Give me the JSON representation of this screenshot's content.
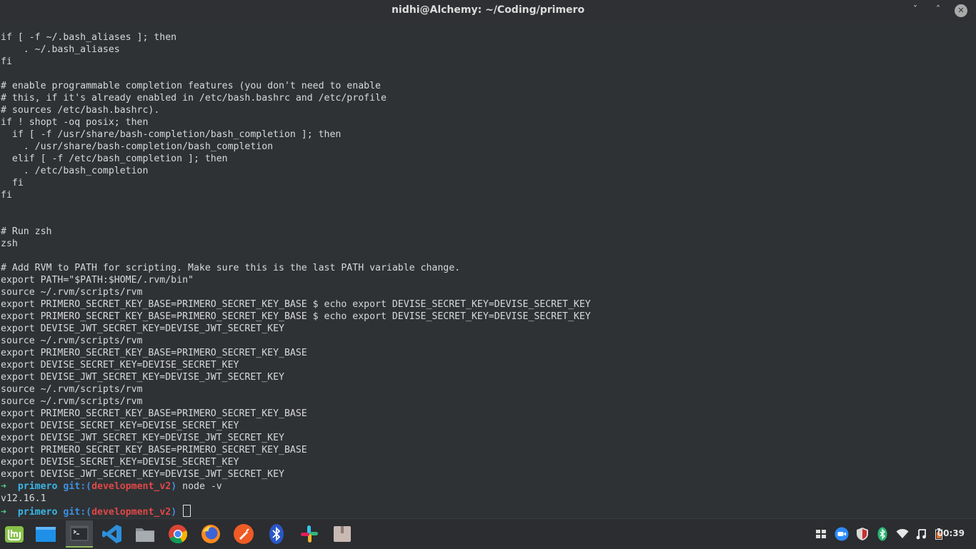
{
  "window": {
    "title": "nidhi@Alchemy: ~/Coding/primero",
    "minimize_glyph": "ˇ",
    "maximize_glyph": "ˆ",
    "close_glyph": "✕"
  },
  "terminal": {
    "lines": [
      "if [ -f ~/.bash_aliases ]; then",
      "    . ~/.bash_aliases",
      "fi",
      "",
      "# enable programmable completion features (you don't need to enable",
      "# this, if it's already enabled in /etc/bash.bashrc and /etc/profile",
      "# sources /etc/bash.bashrc).",
      "if ! shopt -oq posix; then",
      "  if [ -f /usr/share/bash-completion/bash_completion ]; then",
      "    . /usr/share/bash-completion/bash_completion",
      "  elif [ -f /etc/bash_completion ]; then",
      "    . /etc/bash_completion",
      "  fi",
      "fi",
      "",
      "",
      "# Run zsh",
      "zsh",
      "",
      "# Add RVM to PATH for scripting. Make sure this is the last PATH variable change.",
      "export PATH=\"$PATH:$HOME/.rvm/bin\"",
      "source ~/.rvm/scripts/rvm",
      "export PRIMERO_SECRET_KEY_BASE=PRIMERO_SECRET_KEY_BASE $ echo export DEVISE_SECRET_KEY=DEVISE_SECRET_KEY",
      "export PRIMERO_SECRET_KEY_BASE=PRIMERO_SECRET_KEY_BASE $ echo export DEVISE_SECRET_KEY=DEVISE_SECRET_KEY",
      "export DEVISE_JWT_SECRET_KEY=DEVISE_JWT_SECRET_KEY",
      "source ~/.rvm/scripts/rvm",
      "export PRIMERO_SECRET_KEY_BASE=PRIMERO_SECRET_KEY_BASE",
      "export DEVISE_SECRET_KEY=DEVISE_SECRET_KEY",
      "export DEVISE_JWT_SECRET_KEY=DEVISE_JWT_SECRET_KEY",
      "source ~/.rvm/scripts/rvm",
      "source ~/.rvm/scripts/rvm",
      "export PRIMERO_SECRET_KEY_BASE=PRIMERO_SECRET_KEY_BASE",
      "export DEVISE_SECRET_KEY=DEVISE_SECRET_KEY",
      "export DEVISE_JWT_SECRET_KEY=DEVISE_JWT_SECRET_KEY",
      "export PRIMERO_SECRET_KEY_BASE=PRIMERO_SECRET_KEY_BASE",
      "export DEVISE_SECRET_KEY=DEVISE_SECRET_KEY",
      "export DEVISE_JWT_SECRET_KEY=DEVISE_JWT_SECRET_KEY"
    ],
    "prompt1": {
      "arrow": "➜",
      "dir": "primero",
      "git_label": "git:(",
      "branch": "development_v2",
      "git_close": ")",
      "command": "node -v"
    },
    "output": "v12.16.1",
    "prompt2": {
      "arrow": "➜",
      "dir": "primero",
      "git_label": "git:(",
      "branch": "development_v2",
      "git_close": ")"
    }
  },
  "taskbar": {
    "apps": [
      {
        "name": "linux-mint-menu-icon",
        "active": false
      },
      {
        "name": "show-desktop-icon",
        "active": false
      },
      {
        "name": "terminal-icon",
        "active": true
      },
      {
        "name": "vscode-icon",
        "active": false
      },
      {
        "name": "files-icon",
        "active": false
      },
      {
        "name": "chrome-icon",
        "active": false
      },
      {
        "name": "firefox-icon",
        "active": false
      },
      {
        "name": "postman-icon",
        "active": false
      },
      {
        "name": "bluetooth-app-icon",
        "active": false
      },
      {
        "name": "slack-icon",
        "active": false
      },
      {
        "name": "archive-manager-icon",
        "active": false
      }
    ],
    "tray": [
      "workspace-switcher-icon",
      "zoom-icon",
      "update-manager-shield-icon",
      "bluetooth-tray-icon",
      "wifi-icon",
      "music-note-icon",
      "battery-icon"
    ],
    "clock": "00:39"
  }
}
